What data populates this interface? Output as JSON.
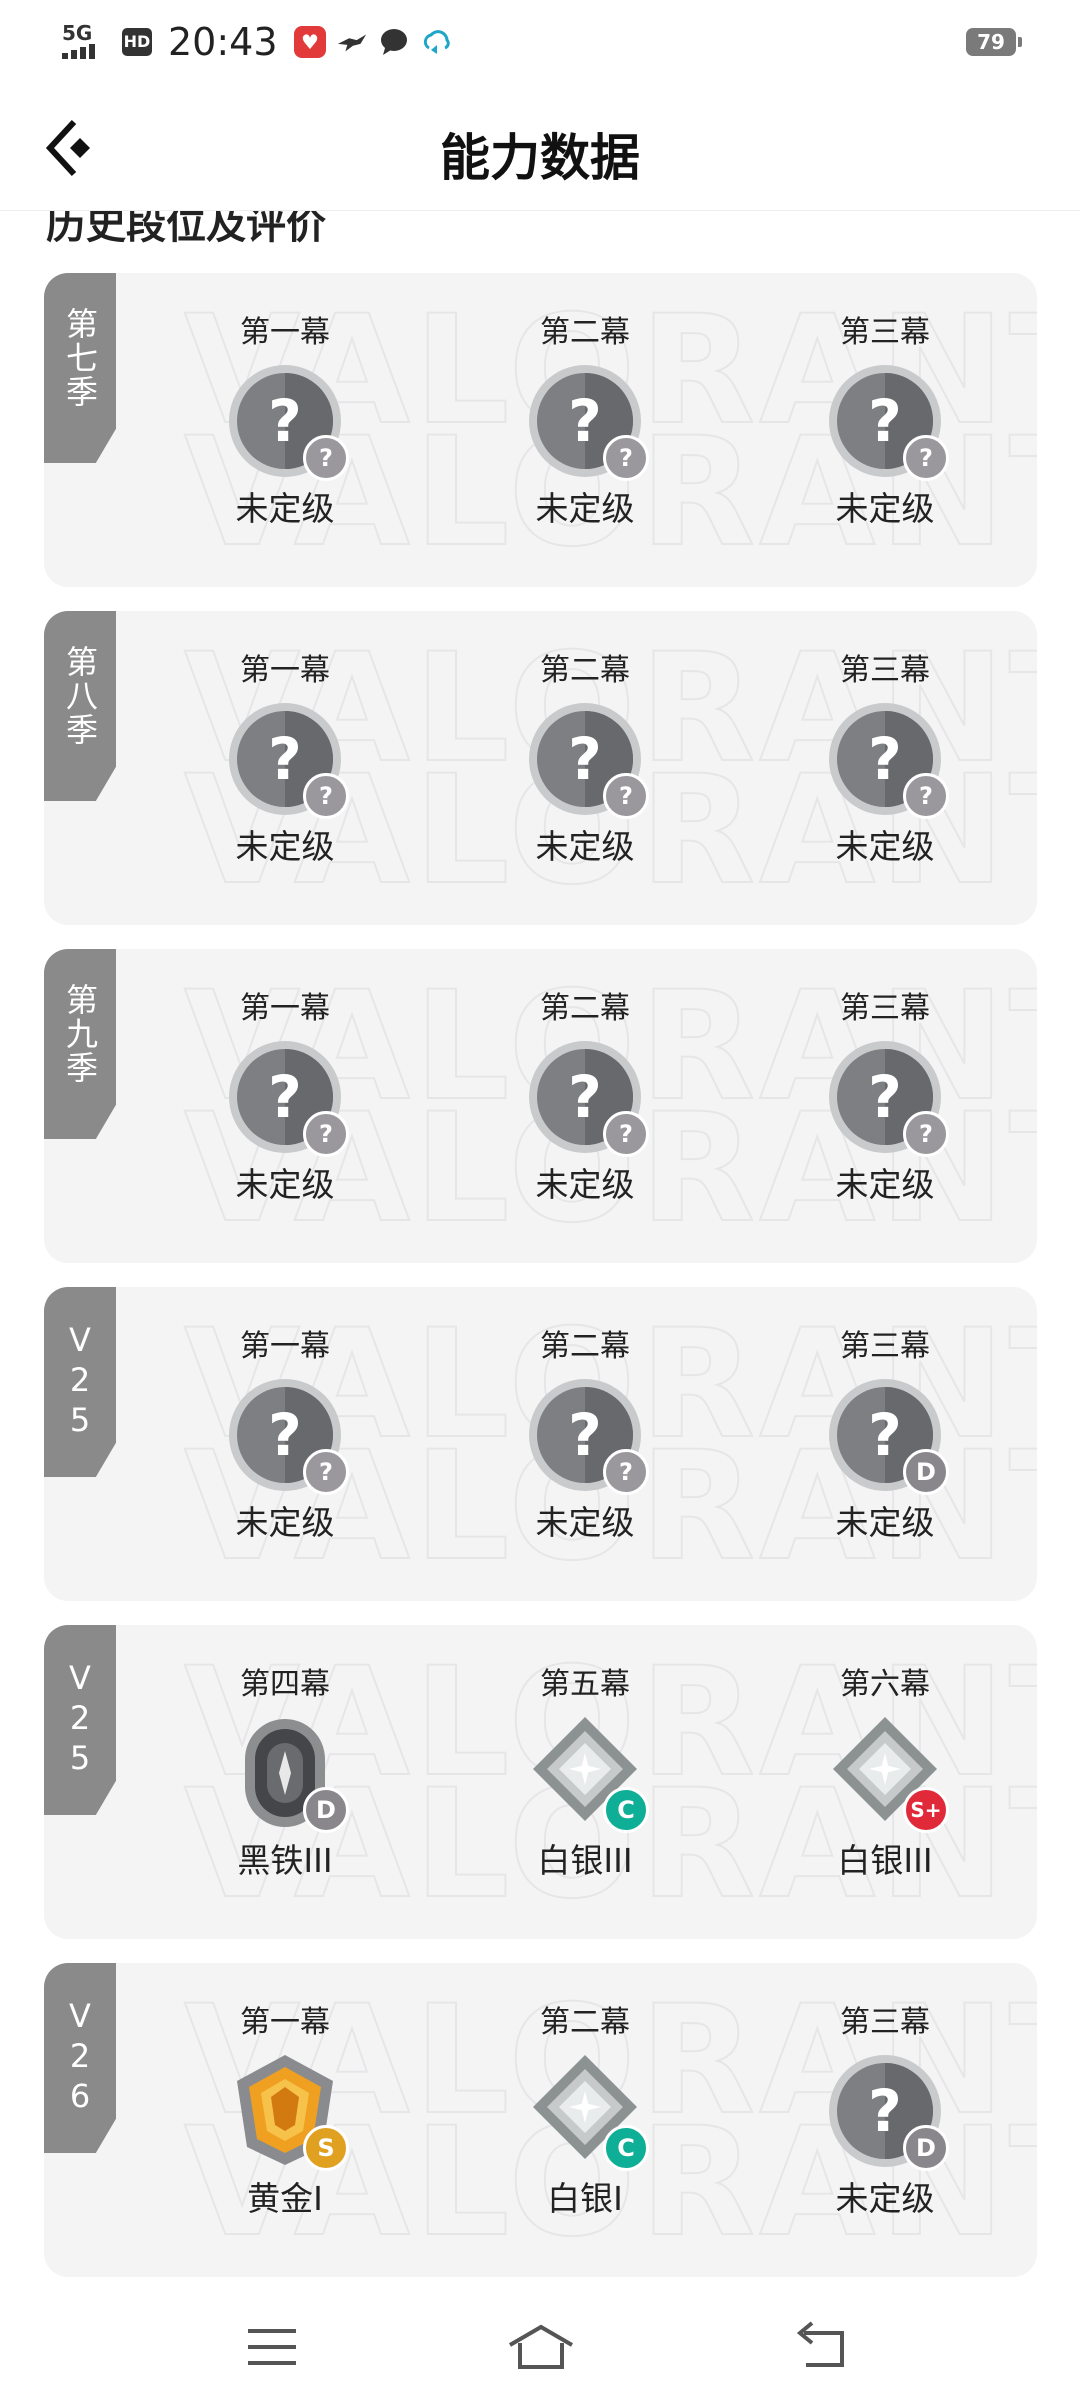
{
  "status_bar": {
    "network": "5G",
    "hd": "HD",
    "time": "20:43",
    "battery": "79",
    "app_icons": [
      "heart-app-icon",
      "bird-app-icon",
      "message-icon",
      "cloud-sync-icon"
    ]
  },
  "header": {
    "title": "能力数据",
    "back_icon": "back-arrow-icon"
  },
  "section_title": "历史段位及评价",
  "cards": [
    {
      "season": "第七季",
      "acts": [
        {
          "label": "第一幕",
          "rank": "未定级",
          "emblem": "unranked",
          "grade": "?"
        },
        {
          "label": "第二幕",
          "rank": "未定级",
          "emblem": "unranked",
          "grade": "?"
        },
        {
          "label": "第三幕",
          "rank": "未定级",
          "emblem": "unranked",
          "grade": "?"
        }
      ]
    },
    {
      "season": "第八季",
      "acts": [
        {
          "label": "第一幕",
          "rank": "未定级",
          "emblem": "unranked",
          "grade": "?"
        },
        {
          "label": "第二幕",
          "rank": "未定级",
          "emblem": "unranked",
          "grade": "?"
        },
        {
          "label": "第三幕",
          "rank": "未定级",
          "emblem": "unranked",
          "grade": "?"
        }
      ]
    },
    {
      "season": "第九季",
      "acts": [
        {
          "label": "第一幕",
          "rank": "未定级",
          "emblem": "unranked",
          "grade": "?"
        },
        {
          "label": "第二幕",
          "rank": "未定级",
          "emblem": "unranked",
          "grade": "?"
        },
        {
          "label": "第三幕",
          "rank": "未定级",
          "emblem": "unranked",
          "grade": "?"
        }
      ]
    },
    {
      "season": "V25",
      "acts": [
        {
          "label": "第一幕",
          "rank": "未定级",
          "emblem": "unranked",
          "grade": "?"
        },
        {
          "label": "第二幕",
          "rank": "未定级",
          "emblem": "unranked",
          "grade": "?"
        },
        {
          "label": "第三幕",
          "rank": "未定级",
          "emblem": "unranked",
          "grade": "D"
        }
      ]
    },
    {
      "season": "V25",
      "acts": [
        {
          "label": "第四幕",
          "rank": "黑铁III",
          "emblem": "iron",
          "grade": "D"
        },
        {
          "label": "第五幕",
          "rank": "白银III",
          "emblem": "silver",
          "grade": "C"
        },
        {
          "label": "第六幕",
          "rank": "白银III",
          "emblem": "silver",
          "grade": "S+"
        }
      ]
    },
    {
      "season": "V26",
      "acts": [
        {
          "label": "第一幕",
          "rank": "黄金I",
          "emblem": "gold",
          "grade": "S"
        },
        {
          "label": "第二幕",
          "rank": "白银I",
          "emblem": "silver",
          "grade": "C"
        },
        {
          "label": "第三幕",
          "rank": "未定级",
          "emblem": "unranked",
          "grade": "D"
        }
      ]
    }
  ],
  "watermark": "VALORANT",
  "grade_colors": {
    "?": "#9a979d",
    "D": "#8a878c",
    "C": "#0fae96",
    "S": "#e0a020",
    "S+": "#e02a3a"
  },
  "nav_bar": {
    "buttons": [
      "menu-icon",
      "home-icon",
      "back-icon"
    ]
  }
}
